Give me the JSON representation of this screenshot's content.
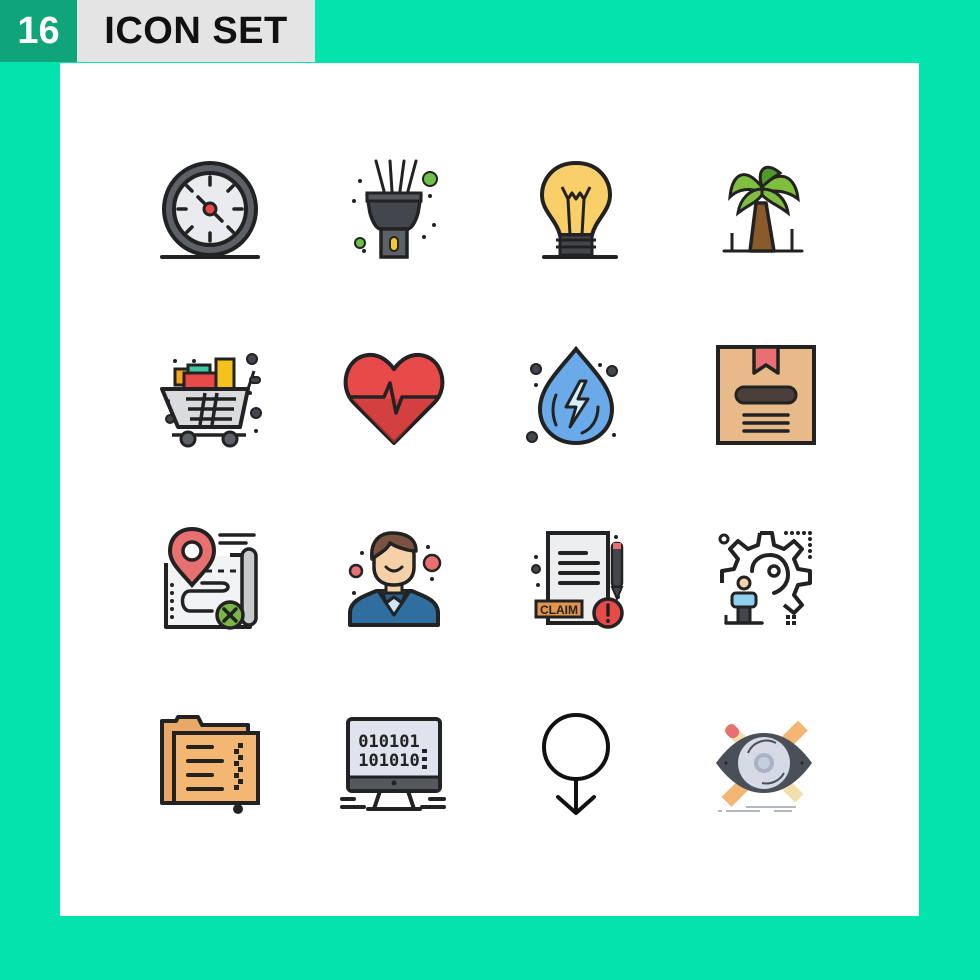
{
  "header": {
    "count": "16",
    "title": "ICON SET"
  },
  "colors": {
    "background": "#02e3ad",
    "count_bg": "#0fa47a",
    "title_bg": "#e4e4e4",
    "panel": "#ffffff"
  },
  "icons": [
    {
      "name": "compass-gauge-icon"
    },
    {
      "name": "flashlight-icon"
    },
    {
      "name": "light-bulb-icon"
    },
    {
      "name": "palm-tree-icon"
    },
    {
      "name": "shopping-cart-icon"
    },
    {
      "name": "heartbeat-icon"
    },
    {
      "name": "water-energy-icon"
    },
    {
      "name": "package-box-icon"
    },
    {
      "name": "map-location-cancel-icon"
    },
    {
      "name": "businessman-icon"
    },
    {
      "name": "claim-document-icon"
    },
    {
      "name": "gear-person-icon"
    },
    {
      "name": "folder-files-icon"
    },
    {
      "name": "binary-monitor-icon"
    },
    {
      "name": "male-symbol-icon"
    },
    {
      "name": "design-eye-icon"
    }
  ],
  "labels": {
    "claim": "CLAIM",
    "binary_top": "010101",
    "binary_bottom": "101010"
  }
}
